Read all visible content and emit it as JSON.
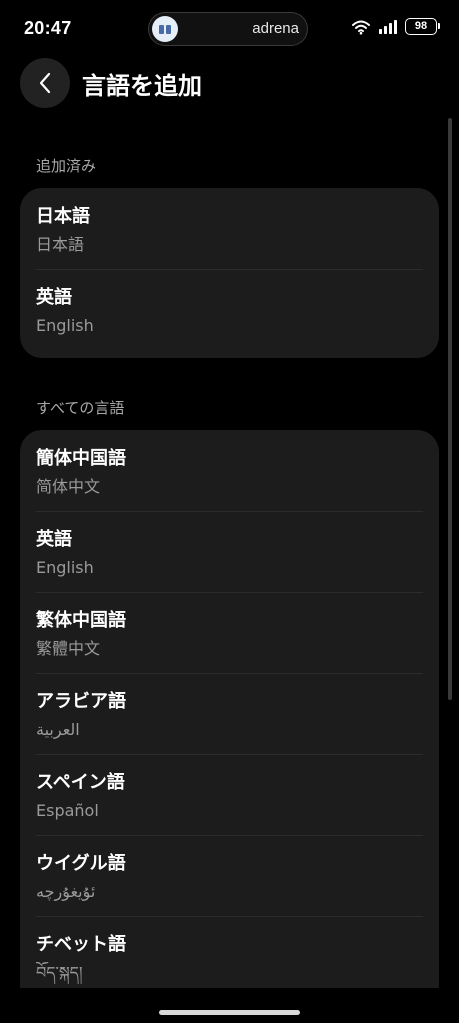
{
  "status_bar": {
    "time": "20:47",
    "island_label": "adrena",
    "battery": "98"
  },
  "header": {
    "title": "言語を追加"
  },
  "added_section": {
    "header": "追加済み",
    "items": [
      {
        "name": "日本語",
        "native": "日本語"
      },
      {
        "name": "英語",
        "native": "English"
      }
    ]
  },
  "all_section": {
    "header": "すべての言語",
    "items": [
      {
        "name": "簡体中国語",
        "native": "简体中文"
      },
      {
        "name": "英語",
        "native": "English"
      },
      {
        "name": "繁体中国語",
        "native": "繁體中文"
      },
      {
        "name": "アラビア語",
        "native": "العربية"
      },
      {
        "name": "スペイン語",
        "native": "Español"
      },
      {
        "name": "ウイグル語",
        "native": "ئۇيغۇرچە"
      },
      {
        "name": "チベット語",
        "native": "བོད་སྐད།"
      }
    ]
  },
  "icons": {
    "back": "back-arrow-icon",
    "wifi": "wifi-icon",
    "signal": "signal-icon",
    "battery": "battery-icon"
  },
  "colors": {
    "background": "#000000",
    "card": "#1c1c1c",
    "secondary_text": "#9a9a9a",
    "section_header": "#a8a8a8"
  }
}
